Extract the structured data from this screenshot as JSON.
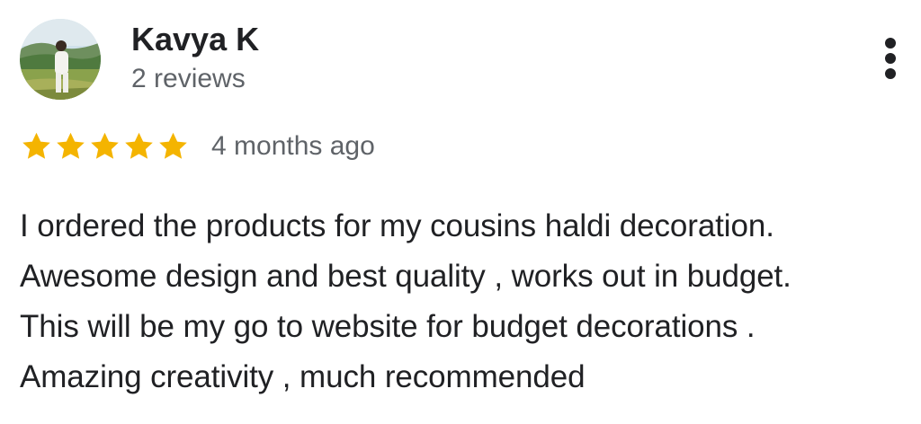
{
  "reviewer": {
    "name": "Kavya K",
    "review_count": "2 reviews",
    "avatar_icon": "person-photo-avatar"
  },
  "more_options": {
    "icon": "more-vertical-icon"
  },
  "rating": {
    "stars": 5,
    "max_stars": 5,
    "star_color": "#f4b400",
    "date": "4 months ago"
  },
  "review": {
    "lines": [
      "I ordered the products for my cousins haldi decoration.",
      "Awesome design and best quality , works out in budget.",
      "This will be my go to website for budget decorations .",
      "Amazing creativity , much recommended"
    ]
  },
  "colors": {
    "text_primary": "#202124",
    "text_secondary": "#5f6368"
  }
}
